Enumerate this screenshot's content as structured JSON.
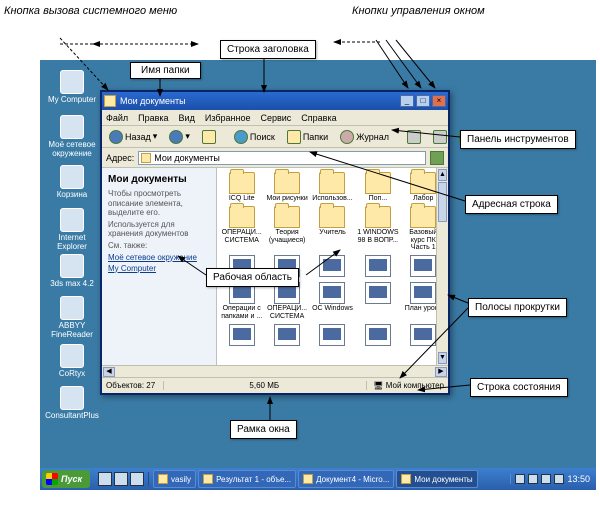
{
  "annotations": {
    "system_menu": "Кнопка вызова системного меню",
    "window_ctrl": "Кнопки управления окном",
    "title_row": "Строка заголовка",
    "folder_name": "Имя папки",
    "tools_panel": "Панель инструментов",
    "address_bar": "Адресная строка",
    "work_area": "Рабочая область",
    "scrollbars": "Полосы прокрутки",
    "status_row": "Строка состояния",
    "frame": "Рамка окна"
  },
  "desktop_icons": [
    {
      "label": "My Computer"
    },
    {
      "label": "Моё сетевое окружение"
    },
    {
      "label": "Корзина"
    },
    {
      "label": "Internet Explorer"
    },
    {
      "label": "3ds max 4.2"
    },
    {
      "label": "ABBYY FineReader"
    },
    {
      "label": "CoRtyx"
    },
    {
      "label": "ConsultantPlus"
    }
  ],
  "window": {
    "title": "Мои документы",
    "menu": [
      "Файл",
      "Правка",
      "Вид",
      "Избранное",
      "Сервис",
      "Справка"
    ],
    "toolbar": {
      "back": "Назад",
      "search": "Поиск",
      "folders": "Папки",
      "journal": "Журнал"
    },
    "address_label": "Адрес:",
    "address_value": "Мои документы",
    "sidebar": {
      "heading": "Мои документы",
      "tip": "Чтобы просмотреть описание элемента, выделите его.",
      "use": "Используется для хранения документов",
      "also": "См. также:",
      "links": [
        "Моё сетевое окружение",
        "My Computer"
      ]
    },
    "files_row1": [
      "ICQ Lite",
      "Мои рисунки",
      "Использов...",
      "Поп...",
      "Лабор"
    ],
    "files_row2": [
      "ОПЕРАЦИ... СИСТЕМА",
      "Теория (учащиеся)",
      "Учитель",
      "1 WINDOWS 98 В ВОПР...",
      "Базовый курс ПК Часть 1"
    ],
    "files_row3": [
      "",
      "",
      "",
      "",
      ""
    ],
    "files_row4": [
      "Операции с папками и ...",
      "ОПЕРАЦИ... СИСТЕМА",
      "ОС Windows",
      "",
      "План урока"
    ],
    "status": {
      "objects": "Объектов: 27",
      "size": "5,60 МБ",
      "location": "Мой компьютер"
    }
  },
  "taskbar": {
    "start": "Пуск",
    "tasks": [
      "vasily",
      "Результат 1 - объе...",
      "Документ4 - Micro...",
      "Мои документы"
    ],
    "time": "13:50"
  }
}
